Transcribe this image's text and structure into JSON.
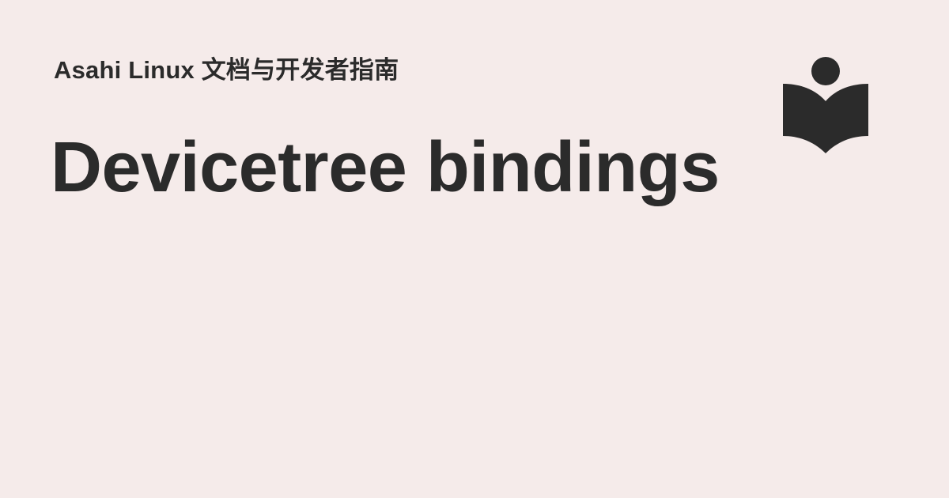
{
  "colors": {
    "background": "#f5ebea",
    "text": "#2b2b2b",
    "logo": "#2b2b2b"
  },
  "header": {
    "site_name": "Asahi Linux 文档与开发者指南"
  },
  "main": {
    "title": "Devicetree bindings"
  },
  "logo": {
    "icon": "reading-person-book-icon"
  }
}
